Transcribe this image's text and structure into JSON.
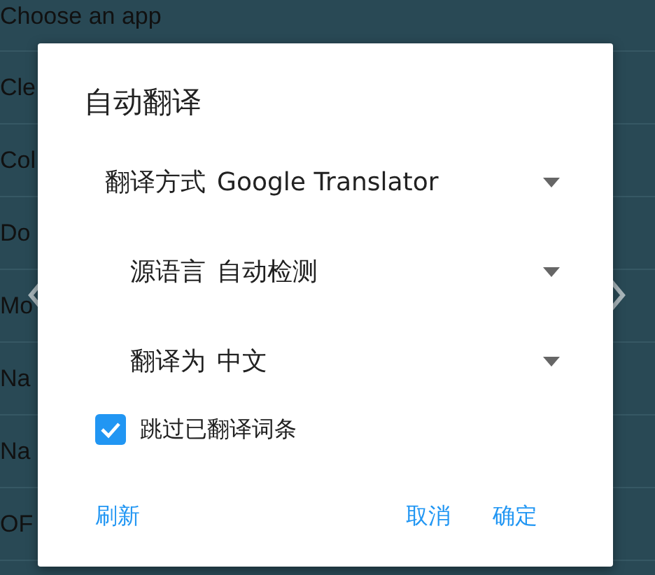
{
  "background_list": {
    "title": "Choose an app",
    "items": [
      "Cle",
      "Col",
      "Do",
      "Mo",
      "Na",
      "Na",
      "OF"
    ]
  },
  "dialog": {
    "title": "自动翻译",
    "fields": [
      {
        "label": "翻译方式",
        "value": "Google Translator"
      },
      {
        "label": "源语言",
        "value": "自动检测"
      },
      {
        "label": "翻译为",
        "value": "中文"
      }
    ],
    "checkbox": {
      "label": "跳过已翻译词条",
      "checked": true
    },
    "buttons": [
      {
        "label": "刷新",
        "kind": "left"
      },
      {
        "label": "取消",
        "kind": "right"
      },
      {
        "label": "确定",
        "kind": "right"
      }
    ]
  }
}
